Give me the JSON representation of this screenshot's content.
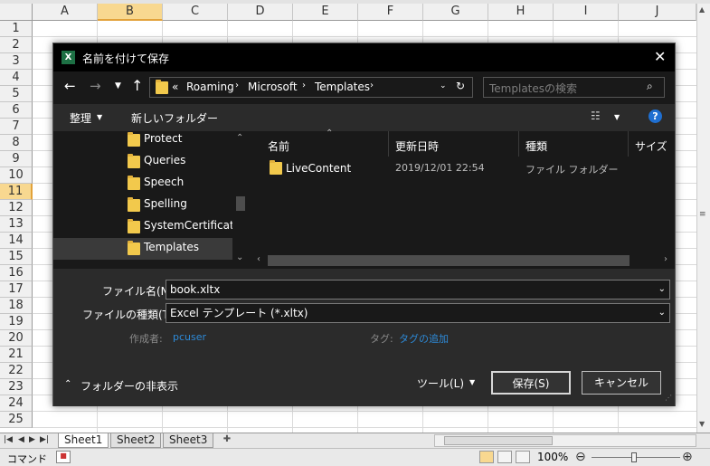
{
  "excel": {
    "columns": [
      "A",
      "B",
      "C",
      "D",
      "E",
      "F",
      "G",
      "H",
      "I",
      "J"
    ],
    "selected_column": "B",
    "rows": [
      "1",
      "2",
      "3",
      "4",
      "5",
      "6",
      "7",
      "8",
      "9",
      "10",
      "11",
      "12",
      "13",
      "14",
      "15",
      "16",
      "17",
      "18",
      "19",
      "20",
      "21",
      "22",
      "23",
      "24",
      "25"
    ],
    "selected_row": "11",
    "sheet_tabs": [
      "Sheet1",
      "Sheet2",
      "Sheet3"
    ],
    "status_mode": "コマンド",
    "zoom": "100%"
  },
  "dialog": {
    "title": "名前を付けて保存",
    "breadcrumb": [
      "Roaming",
      "Microsoft",
      "Templates"
    ],
    "breadcrumb_prefix": "«",
    "search_placeholder": "Templatesの検索",
    "toolbar": {
      "organize": "整理",
      "new_folder": "新しいフォルダー"
    },
    "nav_items": [
      "Protect",
      "Queries",
      "Speech",
      "Spelling",
      "SystemCertificates",
      "Templates"
    ],
    "selected_nav": "Templates",
    "columns": [
      "名前",
      "更新日時",
      "種類",
      "サイズ"
    ],
    "files": [
      {
        "name": "LiveContent",
        "modified": "2019/12/01 22:54",
        "type": "ファイル フォルダー"
      }
    ],
    "filename_label": "ファイル名(N):",
    "filename_value": "book.xltx",
    "filetype_label": "ファイルの種類(T):",
    "filetype_value": "Excel テンプレート (*.xltx)",
    "author_label": "作成者:",
    "author_value": "pcuser",
    "tags_label": "タグ:",
    "tags_value": "タグの追加",
    "hide_folders": "フォルダーの非表示",
    "tools": "ツール(L)",
    "save": "保存(S)",
    "cancel": "キャンセル"
  },
  "colors": {
    "dialog_bg": "#2b2b2b",
    "dialog_dark": "#191919",
    "accent": "#f8d890",
    "link": "#2d8ad8"
  }
}
